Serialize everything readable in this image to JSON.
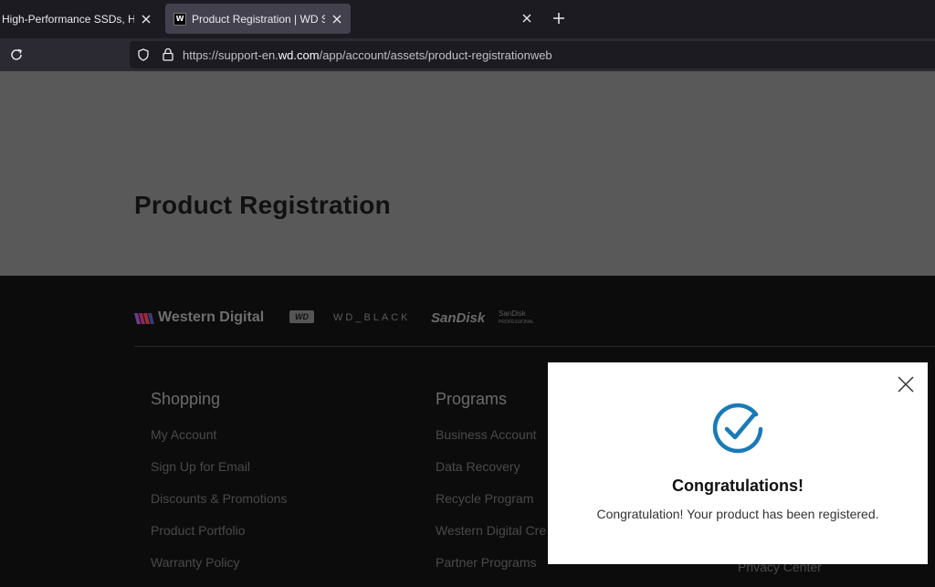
{
  "browser": {
    "tabs": [
      {
        "title": "High-Performance SSDs, HDDs & Flash Storage",
        "active": false
      },
      {
        "title": "Product Registration | WD Support",
        "active": true,
        "favicon": "W"
      }
    ],
    "url_prefix": "https://support-en.",
    "url_domain": "wd.com",
    "url_path": "/app/account/assets/product-registrationweb"
  },
  "page": {
    "title": "Product Registration"
  },
  "footer": {
    "brands": {
      "western_digital": "Western Digital",
      "wd": "WD",
      "wd_black": "WD_BLACK",
      "sandisk": "SanDisk",
      "sandisk_pro_1": "SanDisk",
      "sandisk_pro_2": "PROFESSIONAL"
    },
    "columns": [
      {
        "heading": "Shopping",
        "links": [
          "My Account",
          "Sign Up for Email",
          "Discounts & Promotions",
          "Product Portfolio",
          "Warranty Policy"
        ]
      },
      {
        "heading": "Programs",
        "links": [
          "Business Account",
          "Data Recovery",
          "Recycle Program",
          "Western Digital Cre",
          "Partner Programs"
        ]
      }
    ],
    "privacy_link": "Privacy Center"
  },
  "modal": {
    "title": "Congratulations!",
    "message": "Congratulation! Your product has been registered.",
    "accent_color": "#1a7ab8"
  }
}
